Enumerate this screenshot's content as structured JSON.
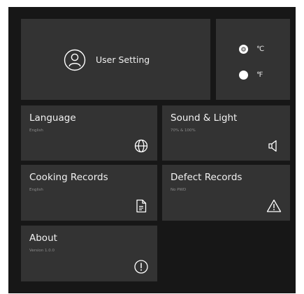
{
  "user_setting": {
    "label": "User Setting",
    "icon": "user-icon"
  },
  "temperature_unit": {
    "options": [
      {
        "label": "℃",
        "selected": true
      },
      {
        "label": "℉",
        "selected": false
      }
    ]
  },
  "tiles": {
    "language": {
      "title": "Language",
      "subtitle": "English",
      "icon": "globe-icon"
    },
    "sound_light": {
      "title": "Sound & Light",
      "subtitle": "70% & 100%",
      "icon": "speaker-icon"
    },
    "cooking_records": {
      "title": "Cooking Records",
      "subtitle": "English",
      "icon": "document-icon"
    },
    "defect_records": {
      "title": "Defect Records",
      "subtitle": "No PWD",
      "icon": "warning-icon"
    },
    "about": {
      "title": "About",
      "subtitle": "Version 1.0.0",
      "icon": "info-icon"
    }
  },
  "colors": {
    "background": "#171717",
    "tile": "#333333",
    "text": "#f2f2f2",
    "subtext": "#8c8c8c"
  }
}
